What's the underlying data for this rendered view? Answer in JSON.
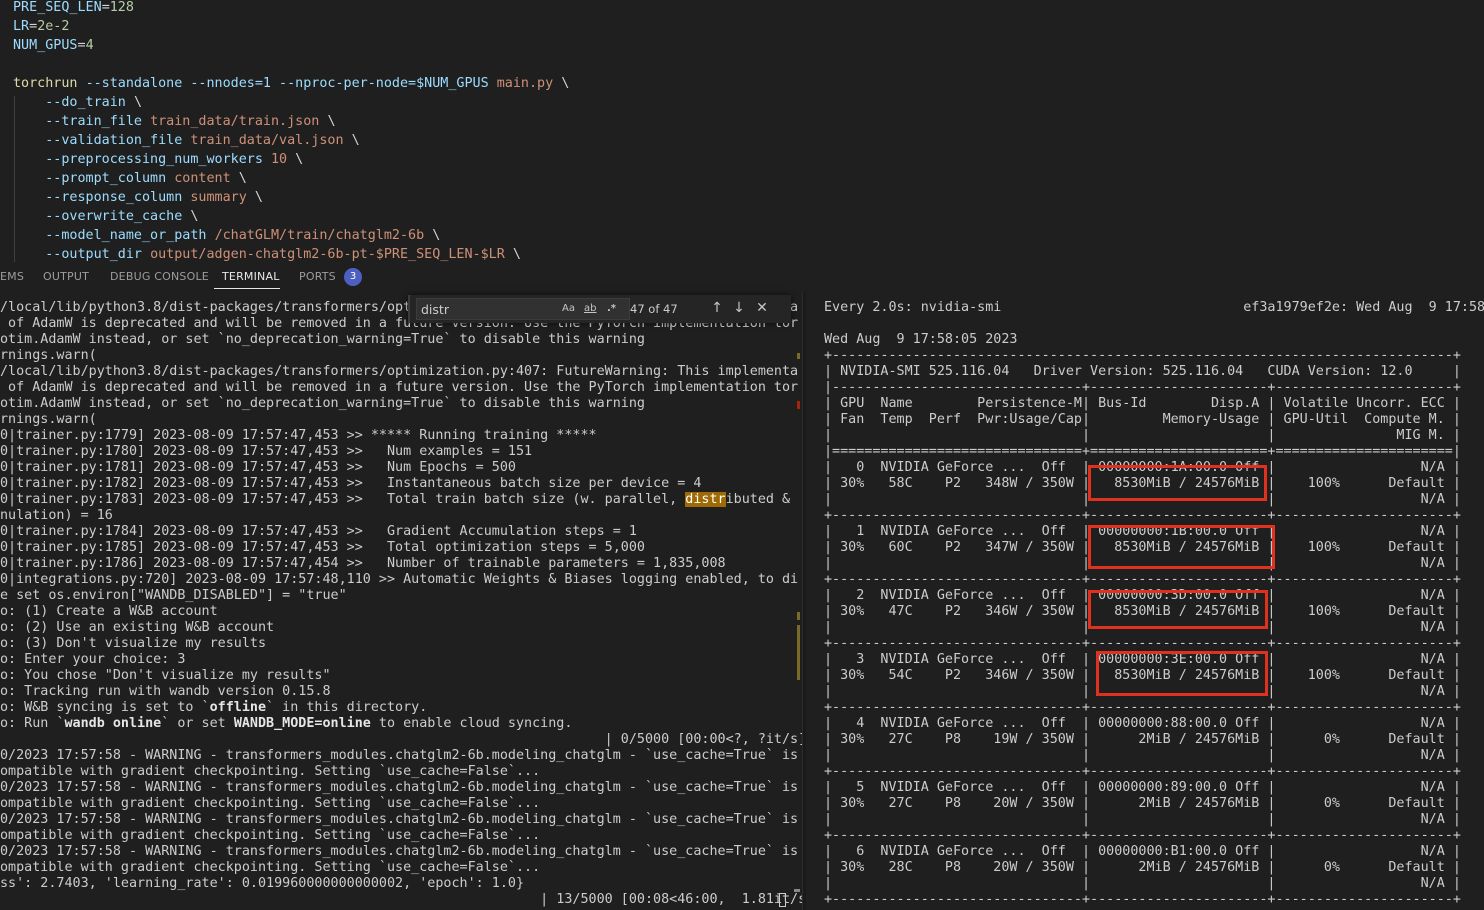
{
  "editor": {
    "line1": {
      "var": "PRE_SEQ_LEN",
      "val": "128"
    },
    "line2": {
      "var": "LR",
      "val": "2e-2"
    },
    "line3": {
      "var": "NUM_GPUS",
      "val": "4"
    },
    "cmd": {
      "torchrun": "torchrun",
      "flags": "--standalone --nnodes=1 --nproc-per-node=",
      "gpus": "$NUM_GPUS",
      "script": "main.py",
      "cont": "\\"
    },
    "args": [
      {
        "flag": "--do_train",
        "val": ""
      },
      {
        "flag": "--train_file",
        "val": "train_data/train.json"
      },
      {
        "flag": "--validation_file",
        "val": "train_data/val.json"
      },
      {
        "flag": "--preprocessing_num_workers",
        "val": "10"
      },
      {
        "flag": "--prompt_column",
        "val": "content"
      },
      {
        "flag": "--response_column",
        "val": "summary"
      },
      {
        "flag": "--overwrite_cache",
        "val": ""
      },
      {
        "flag": "--model_name_or_path",
        "val": "/chatGLM/train/chatglm2-6b"
      },
      {
        "flag": "--output_dir",
        "val": "output/adgen-chatglm2-6b-pt-$PRE_SEQ_LEN-$LR"
      }
    ]
  },
  "panel": {
    "tabs": [
      "EMS",
      "OUTPUT",
      "DEBUG CONSOLE",
      "TERMINAL",
      "PORTS"
    ],
    "ports_badge": "3"
  },
  "find": {
    "query": "distr",
    "opt_case": "Aa",
    "opt_word": "ab",
    "opt_regex": ".*",
    "count": "47 of 47"
  },
  "left_terminal": {
    "lines": [
      "/local/lib/python3.8/dist-packages/transformers/optimization.py:407: FutureWarning: This implementa",
      " of AdamW is deprecated and will be removed in a future version. Use the PyTorch implementation tor",
      "otim.AdamW instead, or set `no_deprecation_warning=True` to disable this warning",
      "rnings.warn(",
      "/local/lib/python3.8/dist-packages/transformers/optimization.py:407: FutureWarning: This implementa",
      " of AdamW is deprecated and will be removed in a future version. Use the PyTorch implementation tor",
      "otim.AdamW instead, or set `no_deprecation_warning=True` to disable this warning",
      "rnings.warn(",
      "0|trainer.py:1779] 2023-08-09 17:57:47,453 >> ***** Running training *****",
      "0|trainer.py:1780] 2023-08-09 17:57:47,453 >>   Num examples = 151",
      "0|trainer.py:1781] 2023-08-09 17:57:47,453 >>   Num Epochs = 500",
      "0|trainer.py:1782] 2023-08-09 17:57:47,453 >>   Instantaneous batch size per device = 4",
      "0|trainer.py:1783] 2023-08-09 17:57:47,453 >>   Total train batch size (w. parallel, ",
      "nulation) = 16",
      "0|trainer.py:1784] 2023-08-09 17:57:47,453 >>   Gradient Accumulation steps = 1",
      "0|trainer.py:1785] 2023-08-09 17:57:47,453 >>   Total optimization steps = 5,000",
      "0|trainer.py:1786] 2023-08-09 17:57:47,454 >>   Number of trainable parameters = 1,835,008",
      "0|integrations.py:720] 2023-08-09 17:57:48,110 >> Automatic Weights & Biases logging enabled, to di",
      "e set os.environ[\"WANDB_DISABLED\"] = \"true\"",
      "o: (1) Create a W&B account",
      "o: (2) Use an existing W&B account",
      "o: (3) Don't visualize my results",
      "o: Enter your choice: 3",
      "o: You chose \"Don't visualize my results\"",
      "o: Tracking run with wandb version 0.15.8",
      "o: W&B syncing is set to ",
      "o: Run ",
      "                                                                           | 0/5000 [00:00<?, ?it/s]",
      "0/2023 17:57:58 - WARNING - transformers_modules.chatglm2-6b.modeling_chatglm - `use_cache=True` is",
      "ompatible with gradient checkpointing. Setting `use_cache=False`...",
      "0/2023 17:57:58 - WARNING - transformers_modules.chatglm2-6b.modeling_chatglm - `use_cache=True` is",
      "ompatible with gradient checkpointing. Setting `use_cache=False`...",
      "0/2023 17:57:58 - WARNING - transformers_modules.chatglm2-6b.modeling_chatglm - `use_cache=True` is",
      "ompatible with gradient checkpointing. Setting `use_cache=False`...",
      "0/2023 17:57:58 - WARNING - transformers_modules.chatglm2-6b.modeling_chatglm - `use_cache=True` is",
      "ompatible with gradient checkpointing. Setting `use_cache=False`...",
      "ss': 2.7403, 'learning_rate': 0.019960000000000002, 'epoch': 1.0}",
      "                                                                   | 13/5000 [00:08<46:00,  1.81it/s]"
    ],
    "highlight": {
      "before": "0|trainer.py:1783] 2023-08-09 17:57:47,453 >>   Total train batch size (w. parallel, ",
      "match": "distr",
      "after": "ibuted &"
    },
    "offline": {
      "word": "offline",
      "after": " in this directory."
    },
    "run": {
      "cmd": "wandb online",
      "mid": " or set ",
      "env": "WANDB_MODE=online",
      "after": " to enable cloud syncing."
    }
  },
  "right_terminal": {
    "lines": [
      "Every 2.0s: nvidia-smi                              ef3a1979ef2e: Wed Aug  9 17:58:05 2",
      "",
      "Wed Aug  9 17:58:05 2023",
      "+-----------------------------------------------------------------------------+",
      "| NVIDIA-SMI 525.116.04   Driver Version: 525.116.04   CUDA Version: 12.0     |",
      "|-------------------------------+----------------------+----------------------+",
      "| GPU  Name        Persistence-M| Bus-Id        Disp.A | Volatile Uncorr. ECC |",
      "| Fan  Temp  Perf  Pwr:Usage/Cap|         Memory-Usage | GPU-Util  Compute M. |",
      "|                               |                      |               MIG M. |",
      "|===============================+======================+======================|",
      "|   0  NVIDIA GeForce ...  Off  | 00000000:1A:00.0 Off |                  N/A |",
      "| 30%   58C    P2   348W / 350W |   8530MiB / 24576MiB |    100%      Default |",
      "|                               |                      |                  N/A |",
      "+-------------------------------+----------------------+----------------------+",
      "|   1  NVIDIA GeForce ...  Off  | 00000000:1B:00.0 Off |                  N/A |",
      "| 30%   60C    P2   347W / 350W |   8530MiB / 24576MiB |    100%      Default |",
      "|                               |                      |                  N/A |",
      "+-------------------------------+----------------------+----------------------+",
      "|   2  NVIDIA GeForce ...  Off  | 00000000:3D:00.0 Off |                  N/A |",
      "| 30%   47C    P2   346W / 350W |   8530MiB / 24576MiB |    100%      Default |",
      "|                               |                      |                  N/A |",
      "+-------------------------------+----------------------+----------------------+",
      "|   3  NVIDIA GeForce ...  Off  | 00000000:3E:00.0 Off |                  N/A |",
      "| 30%   54C    P2   346W / 350W |   8530MiB / 24576MiB |    100%      Default |",
      "|                               |                      |                  N/A |",
      "+-------------------------------+----------------------+----------------------+",
      "|   4  NVIDIA GeForce ...  Off  | 00000000:88:00.0 Off |                  N/A |",
      "| 30%   27C    P8    19W / 350W |      2MiB / 24576MiB |      0%      Default |",
      "|                               |                      |                  N/A |",
      "+-------------------------------+----------------------+----------------------+",
      "|   5  NVIDIA GeForce ...  Off  | 00000000:89:00.0 Off |                  N/A |",
      "| 30%   27C    P8    20W / 350W |      2MiB / 24576MiB |      0%      Default |",
      "|                               |                      |                  N/A |",
      "+-------------------------------+----------------------+----------------------+",
      "|   6  NVIDIA GeForce ...  Off  | 00000000:B1:00.0 Off |                  N/A |",
      "| 30%   28C    P8    20W / 350W |      2MiB / 24576MiB |      0%      Default |",
      "|                               |                      |                  N/A |",
      "+-------------------------------+----------------------+----------------------+"
    ]
  },
  "colors": {
    "background": "#1f1f1f",
    "find_highlight": "#9e6a03",
    "annotation_red": "#e0301e",
    "badge": "#4d5fc1"
  }
}
